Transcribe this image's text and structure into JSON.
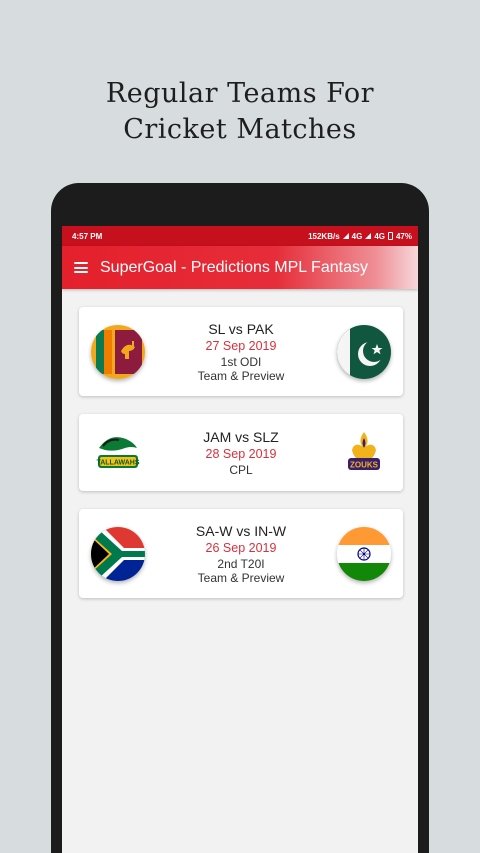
{
  "promo": {
    "line1": "Regular Teams For",
    "line2": "Cricket Matches"
  },
  "status_bar": {
    "time": "4:57 PM",
    "speed": "152KB/s",
    "network1": "4G",
    "network2": "4G",
    "battery": "47%"
  },
  "app_bar": {
    "title": "SuperGoal - Predictions MPL Fantasy"
  },
  "matches": [
    {
      "teams": "SL vs PAK",
      "date": "27 Sep 2019",
      "type": "1st ODI",
      "preview": "Team & Preview",
      "left_icon": "sri-lanka-flag-icon",
      "right_icon": "pakistan-flag-icon"
    },
    {
      "teams": "JAM vs SLZ",
      "date": "28 Sep 2019",
      "type": "CPL",
      "preview": "",
      "left_icon": "jamaica-tallawahs-logo-icon",
      "right_icon": "st-lucia-zouks-logo-icon"
    },
    {
      "teams": "SA-W vs IN-W",
      "date": "26 Sep 2019",
      "type": "2nd T20I",
      "preview": "Team & Preview",
      "left_icon": "south-africa-flag-icon",
      "right_icon": "india-flag-icon"
    }
  ],
  "colors": {
    "status_bar": "#c7101d",
    "app_bar": "#e4202c",
    "date_text": "#d8303c",
    "background": "#d7dcdf"
  }
}
